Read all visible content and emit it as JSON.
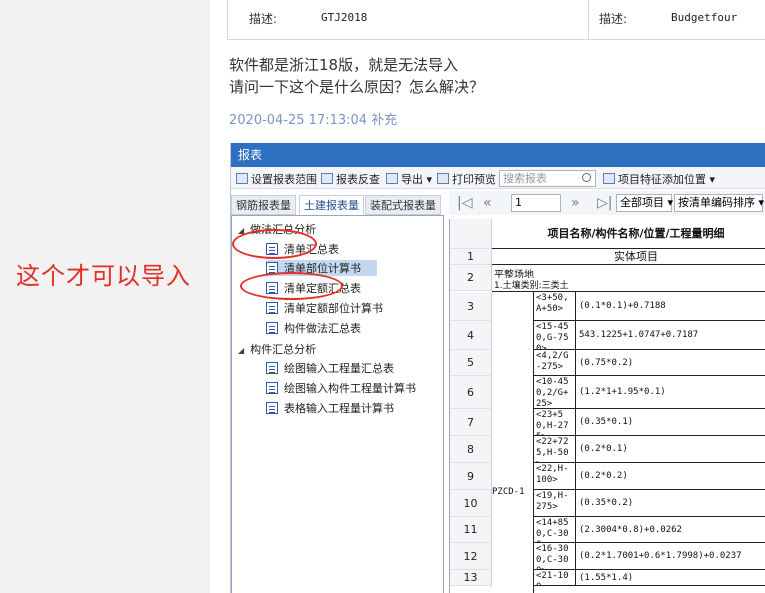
{
  "attachments": [
    {
      "desc_label": "描述:",
      "desc_value": "GTJ2018"
    },
    {
      "desc_label": "描述:",
      "desc_value": "Budgetfour"
    }
  ],
  "question": {
    "line1": "软件都是浙江18版，就是无法导入",
    "line2": "请问一下这个是什么原因？怎么解决？"
  },
  "timestamp": "2020-04-25 17:13:04 补充",
  "annotation": "这个才可以导入",
  "report": {
    "title": "报表",
    "toolbar": {
      "set_range": "设置报表范围",
      "reverse": "报表反查",
      "export": "导出",
      "print_preview": "打印预览",
      "search_placeholder": "搜索报表",
      "add_position": "项目特征添加位置"
    },
    "tabs": [
      "钢筋报表量",
      "土建报表量",
      "装配式报表量"
    ],
    "tree": {
      "group1": "做法汇总分析",
      "group1_items": [
        "清单汇总表",
        "清单部位计算书",
        "清单定额汇总表",
        "清单定额部位计算书",
        "构件做法汇总表"
      ],
      "group2": "构件汇总分析",
      "group2_items": [
        "绘图输入工程量汇总表",
        "绘图输入构件工程量计算书",
        "表格输入工程量计算书"
      ]
    },
    "nav": {
      "page": "1",
      "filter": "全部项目",
      "sort": "按清单编码排序"
    },
    "grid": {
      "header": "项目名称/构件名称/位置/工程量明细",
      "sub_header": "实体项目",
      "item_name": "平整场地",
      "item_desc": "1.土壤类别:三类土",
      "component": "PZCD-1",
      "rows": [
        {
          "n": "1"
        },
        {
          "n": "2"
        },
        {
          "n": "3",
          "pos": "<3+50,A+50>",
          "expr": "(0.1*0.1)+0.7188"
        },
        {
          "n": "4",
          "pos": "<15-450,G-750>",
          "expr": "543.1225+1.0747+0.7187"
        },
        {
          "n": "5",
          "pos": "<4,2/G-275>",
          "expr": "(0.75*0.2)"
        },
        {
          "n": "6",
          "pos": "<10-450,2/G+25>",
          "expr": "(1.2*1+1.95*0.1)"
        },
        {
          "n": "7",
          "pos": "<23+50,H-275>",
          "expr": "(0.35*0.1)"
        },
        {
          "n": "8",
          "pos": "<22+725,H-50>",
          "expr": "(0.2*0.1)"
        },
        {
          "n": "9",
          "pos": "<22,H-100>",
          "expr": "(0.2*0.2)"
        },
        {
          "n": "10",
          "pos": "<19,H-275>",
          "expr": "(0.35*0.2)"
        },
        {
          "n": "11",
          "pos": "<14+850,C-300>",
          "expr": "(2.3004*0.8)+0.0262"
        },
        {
          "n": "12",
          "pos": "<16-300,C-300>",
          "expr": "(0.2*1.7001+0.6*1.7998)+0.0237"
        },
        {
          "n": "13",
          "pos": "<21-100",
          "expr": "(1.55*1.4)"
        }
      ]
    }
  },
  "colors": {
    "accent": "#2f6fc0",
    "annotation": "#e32f26",
    "timestamp": "#7b94c4"
  }
}
